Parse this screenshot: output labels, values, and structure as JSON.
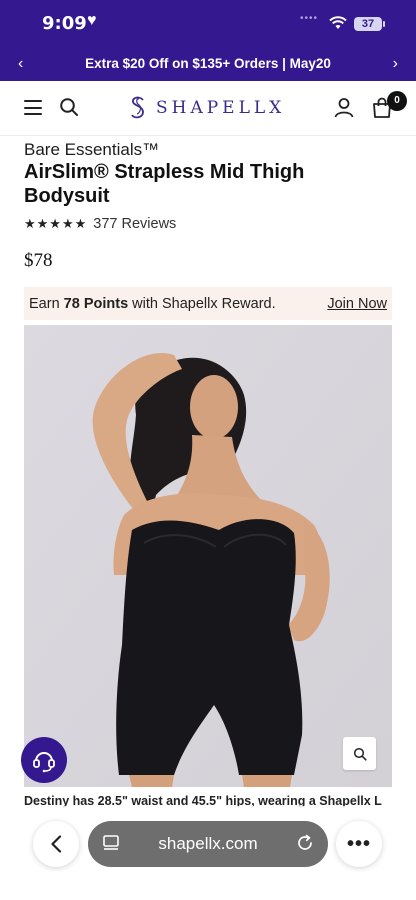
{
  "status_bar": {
    "time": "9:09",
    "battery": "37"
  },
  "promo": {
    "text": "Extra $20 Off on $135+ Orders | May20"
  },
  "header": {
    "brand": "SHAPELLX",
    "cart_count": "0"
  },
  "product": {
    "collection": "Bare Essentials™",
    "title": "AirSlim® Strapless Mid Thigh Bodysuit",
    "rating": 5,
    "stars": "★★★★★",
    "reviews": "377 Reviews",
    "price": "$78"
  },
  "reward": {
    "prefix": "Earn ",
    "points": "78 Points",
    "suffix": " with Shapellx Reward.",
    "join_label": "Join Now"
  },
  "image": {
    "caption": "Destiny has 28.5\" waist and 45.5\" hips, wearing a Shapellx L"
  },
  "browser": {
    "url": "shapellx.com"
  },
  "colors": {
    "brand_purple": "#33188f",
    "reward_bg": "#fbf1ec"
  }
}
